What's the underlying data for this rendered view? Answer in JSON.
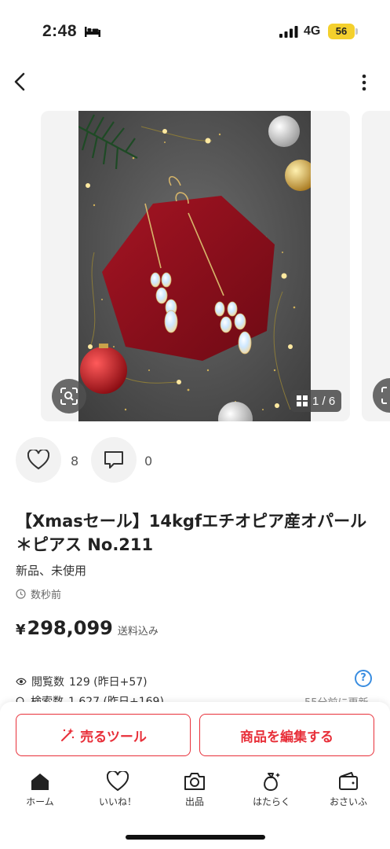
{
  "status_bar": {
    "time": "2:48",
    "network": "4G",
    "battery": "56"
  },
  "gallery": {
    "counter": "1 / 6"
  },
  "actions": {
    "like_count": "8",
    "comment_count": "0"
  },
  "item": {
    "title": "【Xmasセール】14kgfエチオピア産オパール＊ピアス No.211",
    "condition": "新品、未使用",
    "posted": "数秒前",
    "price_currency": "¥",
    "price": "298,099",
    "price_note": "送料込み"
  },
  "stats": {
    "views_label": "閲覧数",
    "views_value": "129 (昨日+57)",
    "search_label": "検索数",
    "search_value": "1,627 (昨日+169)",
    "updated": "55分前に更新",
    "help": "?"
  },
  "bottom_actions": {
    "sell_tool": "売るツール",
    "edit_item": "商品を編集する"
  },
  "tabs": [
    "ホーム",
    "いいね！",
    "出品",
    "はたらく",
    "おさいふ"
  ],
  "colors": {
    "accent": "#e8303a",
    "battery": "#f4d02d",
    "help_blue": "#3a8de0"
  }
}
